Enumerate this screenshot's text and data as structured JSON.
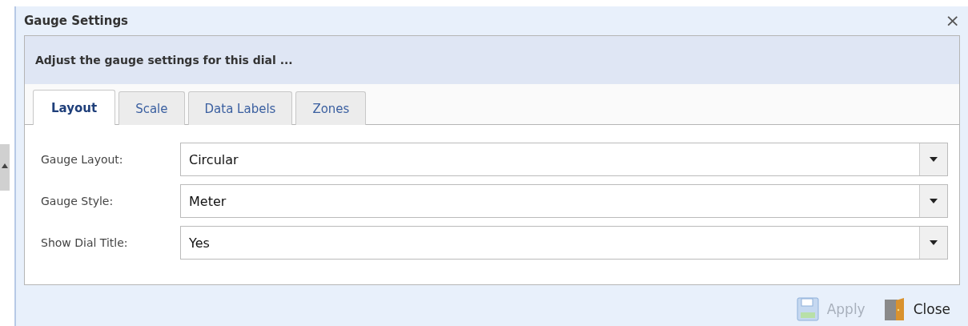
{
  "window": {
    "title": "Gauge Settings",
    "close_glyph": "×"
  },
  "header": {
    "text": "Adjust the gauge settings for this dial ..."
  },
  "tabs": [
    {
      "label": "Layout",
      "selected": true
    },
    {
      "label": "Scale",
      "selected": false
    },
    {
      "label": "Data Labels",
      "selected": false
    },
    {
      "label": "Zones",
      "selected": false
    }
  ],
  "fields": [
    {
      "label": "Gauge Layout:",
      "value": "Circular"
    },
    {
      "label": "Gauge Style:",
      "value": "Meter"
    },
    {
      "label": "Show Dial Title:",
      "value": "Yes"
    }
  ],
  "buttons": [
    {
      "label": "Apply",
      "kind": "save",
      "disabled": true
    },
    {
      "label": "Close",
      "kind": "door",
      "disabled": false
    }
  ]
}
